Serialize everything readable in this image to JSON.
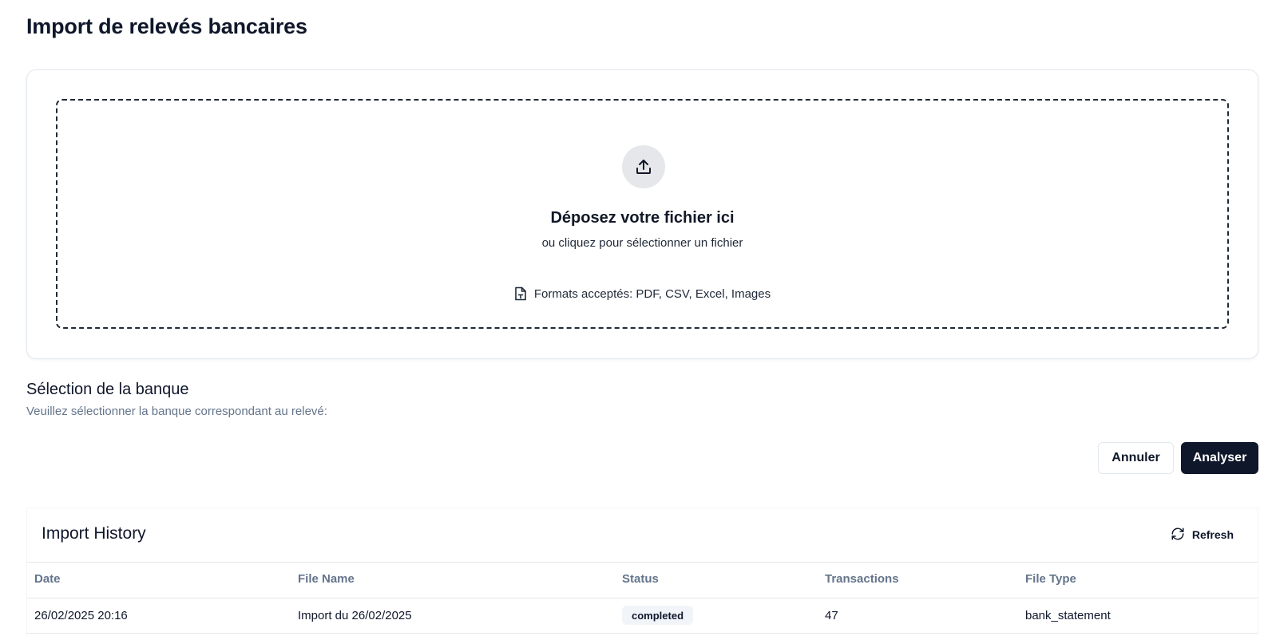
{
  "page": {
    "title": "Import de relevés bancaires"
  },
  "dropzone": {
    "icon": "upload-icon",
    "title": "Déposez votre fichier ici",
    "subtitle": "ou cliquez pour sélectionner un fichier",
    "formats_icon": "file-icon",
    "formats": "Formats acceptés: PDF, CSV, Excel, Images"
  },
  "bank": {
    "title": "Sélection de la banque",
    "subtitle": "Veuillez sélectionner la banque correspondant au relevé:"
  },
  "actions": {
    "cancel_label": "Annuler",
    "analyze_label": "Analyser"
  },
  "history": {
    "title": "Import History",
    "refresh_label": "Refresh",
    "refresh_icon": "refresh-icon",
    "columns": [
      "Date",
      "File Name",
      "Status",
      "Transactions",
      "File Type"
    ],
    "rows": [
      {
        "date": "26/02/2025 20:16",
        "file_name": "Import du 26/02/2025",
        "status": "completed",
        "transactions": "47",
        "file_type": "bank_statement"
      }
    ]
  },
  "colors": {
    "primary": "#0f172a",
    "muted": "#64748b",
    "border": "#e2e8f0",
    "badge_bg": "#f1f5f9"
  }
}
